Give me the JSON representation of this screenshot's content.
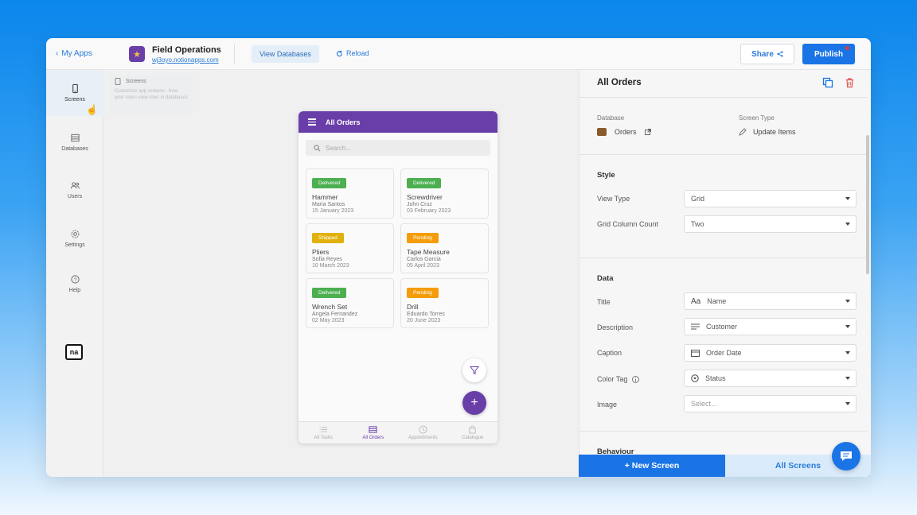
{
  "topbar": {
    "back_label": "My Apps",
    "app_title": "Field Operations",
    "app_url": "wj3oyo.notionapps.com",
    "view_databases": "View Databases",
    "reload": "Reload",
    "share": "Share",
    "publish": "Publish"
  },
  "nav": {
    "items": [
      {
        "label": "Screens",
        "icon": "phone-icon"
      },
      {
        "label": "Databases",
        "icon": "database-icon"
      },
      {
        "label": "Users",
        "icon": "users-icon"
      },
      {
        "label": "Settings",
        "icon": "gear-icon"
      },
      {
        "label": "Help",
        "icon": "help-icon"
      }
    ],
    "logo": "na"
  },
  "tooltip": {
    "title": "Screens",
    "body": "Customize app screens - how your users view rows in databases"
  },
  "phone": {
    "header_title": "All Orders",
    "search_placeholder": "Search...",
    "cards": [
      {
        "status": "Delivered",
        "name": "Hammer",
        "customer": "Maria Santos",
        "date": "15 January 2023",
        "color": "#4caf50"
      },
      {
        "status": "Delivered",
        "name": "Screwdriver",
        "customer": "John Cruz",
        "date": "03 February 2023",
        "color": "#4caf50"
      },
      {
        "status": "Shipped",
        "name": "Pliers",
        "customer": "Sofia Reyes",
        "date": "10 March 2023",
        "color": "#e0b10a"
      },
      {
        "status": "Pending",
        "name": "Tape Measure",
        "customer": "Carlos Garcia",
        "date": "05 April 2023",
        "color": "#f59c0b"
      },
      {
        "status": "Delivered",
        "name": "Wrench Set",
        "customer": "Angela Fernandez",
        "date": "02 May 2023",
        "color": "#4caf50"
      },
      {
        "status": "Pending",
        "name": "Drill",
        "customer": "Eduardo Torres",
        "date": "20 June 2023",
        "color": "#f59c0b"
      }
    ],
    "tabs": [
      {
        "label": "All Tasks",
        "icon": "list-icon",
        "active": false
      },
      {
        "label": "All Orders",
        "icon": "orders-icon",
        "active": true
      },
      {
        "label": "Appointments",
        "icon": "clock-icon",
        "active": false
      },
      {
        "label": "Catalogue",
        "icon": "bag-icon",
        "active": false
      }
    ],
    "accent": "#6a3ea8"
  },
  "panel": {
    "title": "All Orders",
    "database_label": "Database",
    "database_value": "Orders",
    "screen_type_label": "Screen Type",
    "screen_type_value": "Update Items",
    "style_heading": "Style",
    "view_type_label": "View Type",
    "view_type_value": "Grid",
    "grid_col_label": "Grid Column Count",
    "grid_col_value": "Two",
    "data_heading": "Data",
    "title_label": "Title",
    "title_prefix": "Aa",
    "title_value": "Name",
    "description_label": "Description",
    "description_value": "Customer",
    "caption_label": "Caption",
    "caption_value": "Order Date",
    "color_tag_label": "Color Tag",
    "color_tag_value": "Status",
    "image_label": "Image",
    "image_placeholder": "Select...",
    "behaviour_heading": "Behaviour"
  },
  "bottom": {
    "new_screen": "+ New Screen",
    "all_screens": "All Screens"
  },
  "colors": {
    "primary": "#1a74e5",
    "purple": "#6a3ea8"
  }
}
